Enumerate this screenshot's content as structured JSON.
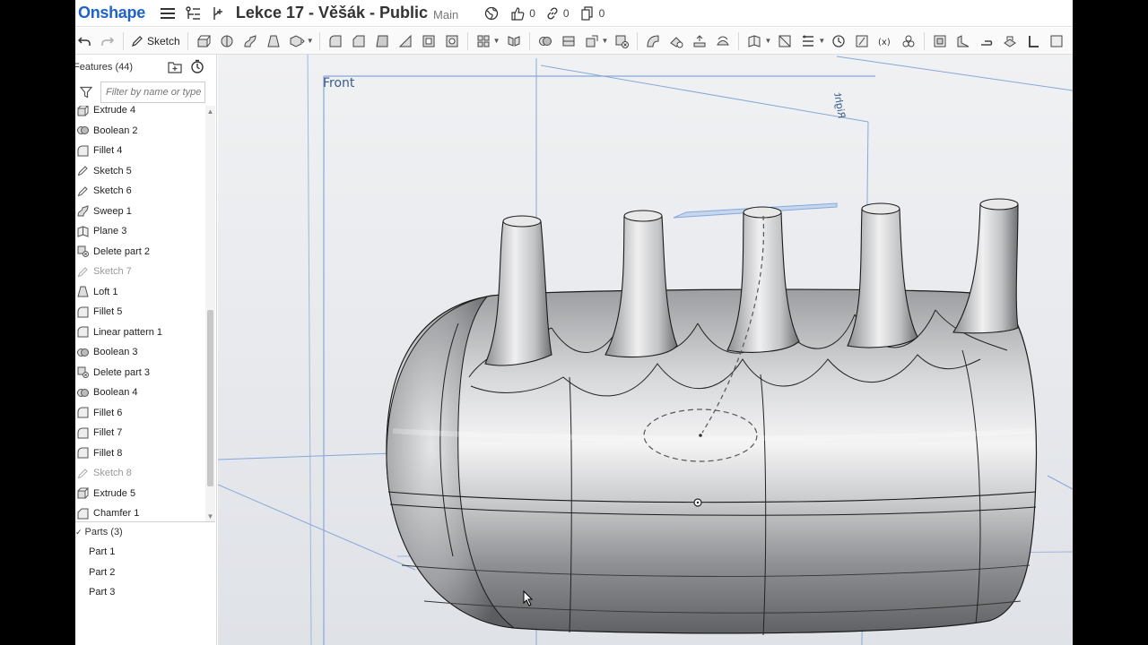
{
  "app": {
    "logo": "Onshape",
    "document_title": "Lekce 17 - Věšák - Public",
    "branch": "Main",
    "likes": "0",
    "links": "0",
    "copies": "0"
  },
  "toolbar": {
    "sketch_label": "Sketch"
  },
  "panel": {
    "title": "Features (44)",
    "filter_placeholder": "Filter by name or type",
    "features": [
      {
        "label": "Extrude 4",
        "icon": "extrude-icon",
        "suppressed": false
      },
      {
        "label": "Boolean 2",
        "icon": "boolean-icon",
        "suppressed": false
      },
      {
        "label": "Fillet 4",
        "icon": "fillet-icon",
        "suppressed": false
      },
      {
        "label": "Sketch 5",
        "icon": "sketch-icon",
        "suppressed": false
      },
      {
        "label": "Sketch 6",
        "icon": "sketch-icon",
        "suppressed": false
      },
      {
        "label": "Sweep 1",
        "icon": "sweep-icon",
        "suppressed": false
      },
      {
        "label": "Plane 3",
        "icon": "plane-icon",
        "suppressed": false
      },
      {
        "label": "Delete part 2",
        "icon": "delete-part-icon",
        "suppressed": false
      },
      {
        "label": "Sketch 7",
        "icon": "sketch-icon",
        "suppressed": true
      },
      {
        "label": "Loft 1",
        "icon": "loft-icon",
        "suppressed": false
      },
      {
        "label": "Fillet 5",
        "icon": "fillet-icon",
        "suppressed": false
      },
      {
        "label": "Linear pattern 1",
        "icon": "linear-pattern-icon",
        "suppressed": false
      },
      {
        "label": "Boolean 3",
        "icon": "boolean-icon",
        "suppressed": false
      },
      {
        "label": "Delete part 3",
        "icon": "delete-part-icon",
        "suppressed": false
      },
      {
        "label": "Boolean 4",
        "icon": "boolean-icon",
        "suppressed": false
      },
      {
        "label": "Fillet 6",
        "icon": "fillet-icon",
        "suppressed": false
      },
      {
        "label": "Fillet 7",
        "icon": "fillet-icon",
        "suppressed": false
      },
      {
        "label": "Fillet 8",
        "icon": "fillet-icon",
        "suppressed": false
      },
      {
        "label": "Sketch 8",
        "icon": "sketch-icon",
        "suppressed": true
      },
      {
        "label": "Extrude 5",
        "icon": "extrude-icon",
        "suppressed": false
      },
      {
        "label": "Chamfer 1",
        "icon": "chamfer-icon",
        "suppressed": false
      }
    ],
    "parts_header": "Parts (3)",
    "parts": [
      "Part 1",
      "Part 2",
      "Part 3"
    ]
  },
  "viewport": {
    "front_plane_label": "Front",
    "right_plane_label": "Right"
  },
  "colors": {
    "brand": "#1f63c6",
    "plane": "#7fa6d9",
    "model": "#b9bbbe"
  }
}
